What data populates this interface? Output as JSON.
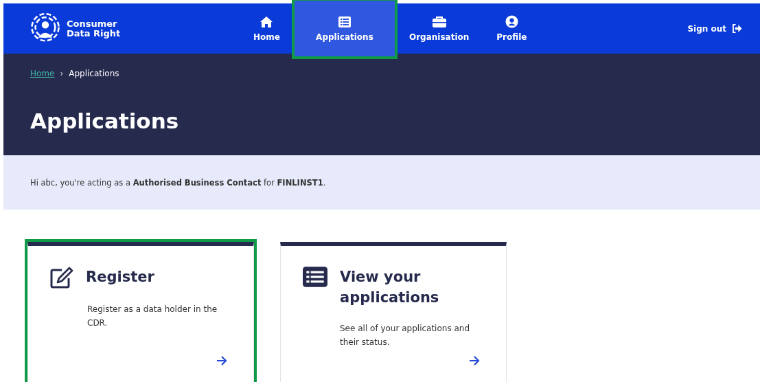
{
  "logo": {
    "line1": "Consumer",
    "line2": "Data Right"
  },
  "nav": [
    {
      "label": "Home",
      "kind": "home",
      "selected": false,
      "highlighted": false
    },
    {
      "label": "Applications",
      "kind": "list",
      "selected": true,
      "highlighted": true
    },
    {
      "label": "Organisation",
      "kind": "briefcase",
      "selected": false,
      "highlighted": false
    },
    {
      "label": "Profile",
      "kind": "user",
      "selected": false,
      "highlighted": false
    }
  ],
  "sign_out": "Sign out",
  "breadcrumb": [
    {
      "label": "Home",
      "link": true
    },
    {
      "label": "Applications",
      "link": false
    }
  ],
  "breadcrumb_separator": "›",
  "page_title": "Applications",
  "notice": "Hi abc, you're acting as a **Authorised Business Contact** for **FINLINST1**.",
  "cards": [
    {
      "kind": "edit",
      "title": "Register",
      "text": "Register as a data holder in the CDR.",
      "highlighted": true
    },
    {
      "kind": "list",
      "title": "View your applications",
      "text": "See all of your applications and their status.",
      "highlighted": false
    }
  ]
}
